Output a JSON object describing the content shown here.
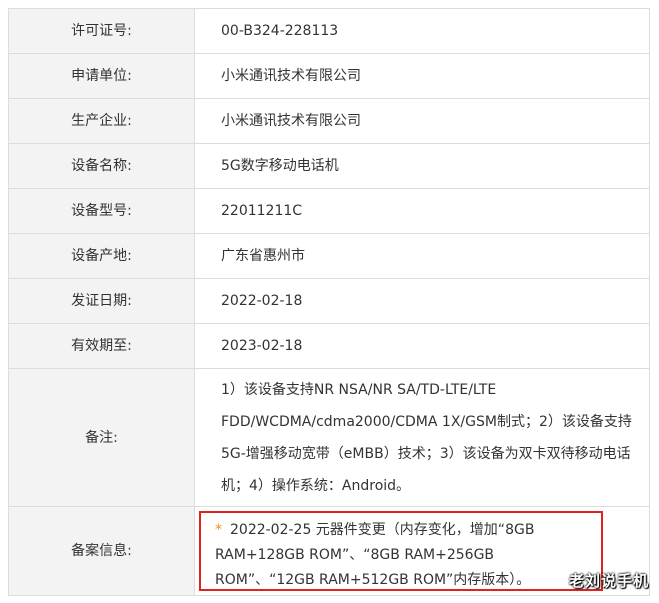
{
  "rows": [
    {
      "label": "许可证号:",
      "value": "00-B324-228113"
    },
    {
      "label": "申请单位:",
      "value": "小米通讯技术有限公司"
    },
    {
      "label": "生产企业:",
      "value": "小米通讯技术有限公司"
    },
    {
      "label": "设备名称:",
      "value": "5G数字移动电话机"
    },
    {
      "label": "设备型号:",
      "value": "22011211C"
    },
    {
      "label": "设备产地:",
      "value": "广东省惠州市"
    },
    {
      "label": "发证日期:",
      "value": "2022-02-18"
    },
    {
      "label": "有效期至:",
      "value": "2023-02-18"
    }
  ],
  "remark": {
    "label": "备注:",
    "value": "1）该设备支持NR NSA/NR SA/TD-LTE/LTE FDD/WCDMA/cdma2000/CDMA 1X/GSM制式；2）该设备支持5G-增强移动宽带（eMBB）技术；3）该设备为双卡双待移动电话机；4）操作系统：Android。"
  },
  "record": {
    "label": "备案信息:",
    "asterisk": "*",
    "value": "2022-02-25 元器件变更（内存变化，增加“8GB RAM+128GB ROM”、“8GB RAM+256GB ROM”、“12GB RAM+512GB ROM”内存版本）。"
  },
  "watermark": "老刘说手机",
  "colors": {
    "label_bg": "#f3f3f3",
    "border": "#dcdcdc",
    "highlight_box": "#e0211f",
    "asterisk": "#f08c1e"
  }
}
